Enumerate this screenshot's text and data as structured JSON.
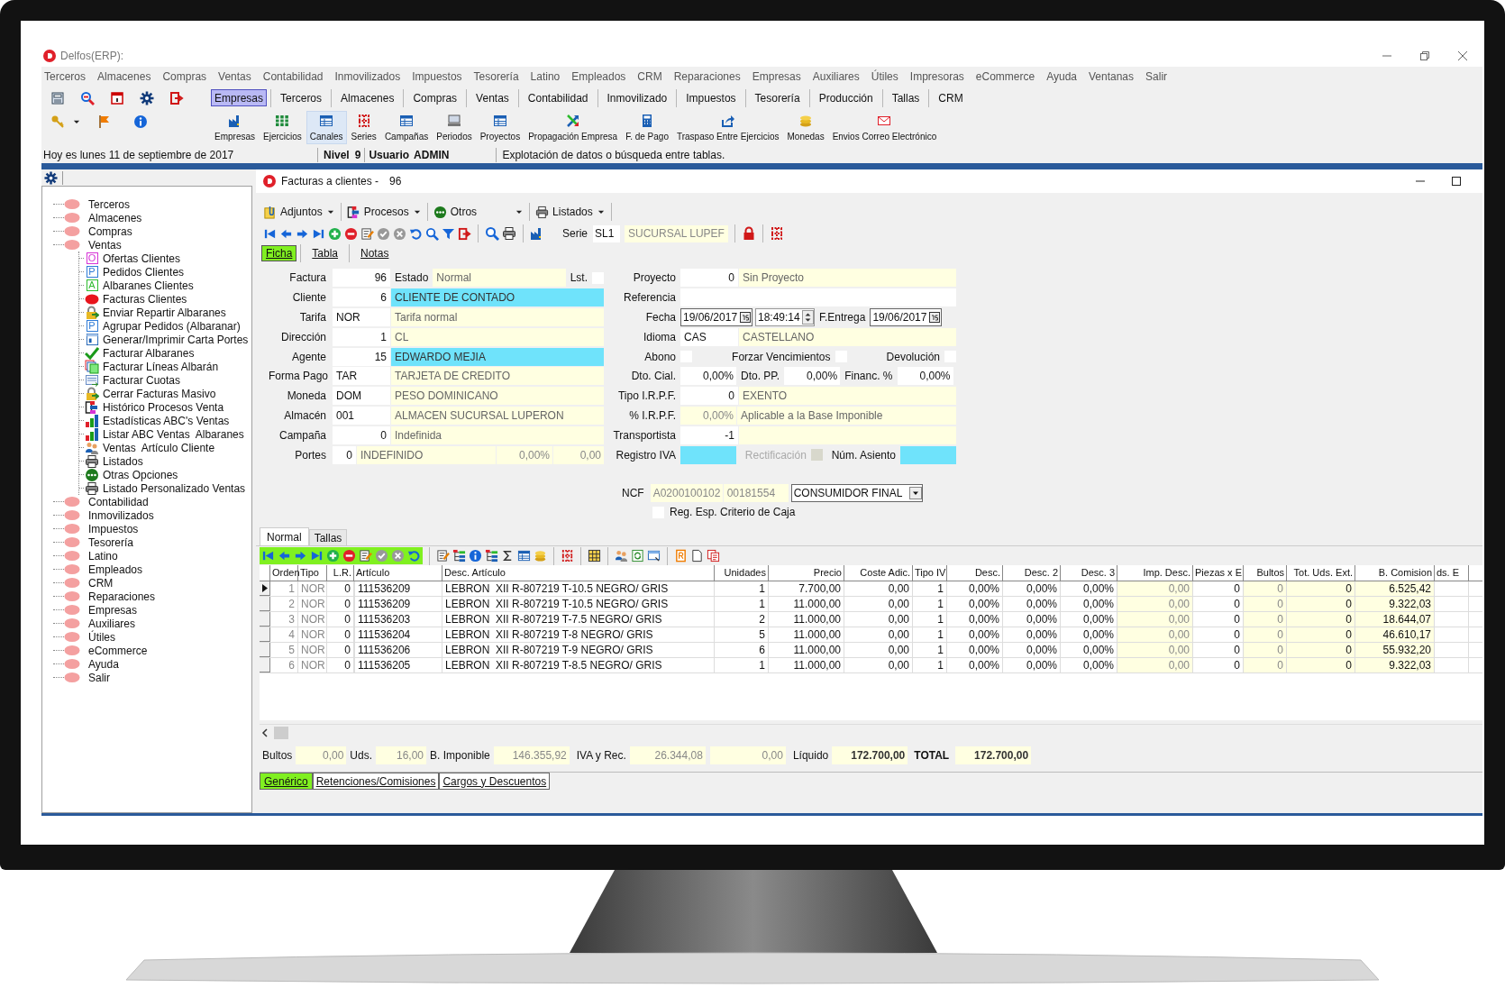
{
  "app": {
    "title": "Delfos(ERP):"
  },
  "menu": [
    "Terceros",
    "Almacenes",
    "Compras",
    "Ventas",
    "Contabilidad",
    "Inmovilizados",
    "Impuestos",
    "Tesorería",
    "Latino",
    "Empleados",
    "CRM",
    "Reparaciones",
    "Empresas",
    "Auxiliares",
    "Útiles",
    "Impresoras",
    "eCommerce",
    "Ayuda",
    "Ventanas",
    "Salir"
  ],
  "module_tabs": [
    {
      "label": "Empresas",
      "selected": true
    },
    {
      "label": "Terceros",
      "selected": false
    },
    {
      "label": "Almacenes",
      "selected": false
    },
    {
      "label": "Compras",
      "selected": false
    },
    {
      "label": "Ventas",
      "selected": false
    },
    {
      "label": "Contabilidad",
      "selected": false
    },
    {
      "label": "Inmovilizado",
      "selected": false
    },
    {
      "label": "Impuestos",
      "selected": false
    },
    {
      "label": "Tesorería",
      "selected": false
    },
    {
      "label": "Producción",
      "selected": false
    },
    {
      "label": "Tallas",
      "selected": false
    },
    {
      "label": "CRM",
      "selected": false
    }
  ],
  "module_tools": [
    {
      "label": "Empresas",
      "selected": false
    },
    {
      "label": "Ejercicios",
      "selected": false
    },
    {
      "label": "Canales",
      "selected": true
    },
    {
      "label": "Series",
      "selected": false
    },
    {
      "label": "Campañas",
      "selected": false
    },
    {
      "label": "Periodos",
      "selected": false
    },
    {
      "label": "Proyectos",
      "selected": false
    },
    {
      "label": "Propagación Empresa",
      "selected": false
    },
    {
      "label": "F. de Pago",
      "selected": false
    },
    {
      "label": "Traspaso Entre Ejercicios",
      "selected": false
    },
    {
      "label": "Monedas",
      "selected": false
    },
    {
      "label": "Envios Correo Electrónico",
      "selected": false
    }
  ],
  "status_bar": {
    "date": "Hoy es lunes 11 de septiembre de 2017",
    "nivel_label": "Nivel",
    "nivel": "9",
    "user_label": "Usuario",
    "user": "ADMIN",
    "message": "Explotación de datos o búsqueda entre tablas."
  },
  "sidebar": {
    "items": [
      {
        "label": "Terceros"
      },
      {
        "label": "Almacenes"
      },
      {
        "label": "Compras"
      },
      {
        "label": "Ventas",
        "children": [
          {
            "label": "Ofertas Clientes",
            "kind": "letter",
            "icon_text": "O",
            "color": "#d633d6"
          },
          {
            "label": "Pedidos Clientes",
            "kind": "letter",
            "icon_text": "P",
            "color": "#2f7bd6"
          },
          {
            "label": "Albaranes Clientes",
            "kind": "letter",
            "icon_text": "A",
            "color": "#2dbb2d"
          },
          {
            "label": "Facturas Clientes",
            "kind": "blob"
          },
          {
            "label": "Enviar Repartir Albaranes",
            "kind": "lock"
          },
          {
            "label": "Agrupar Pedidos (Albaranar)",
            "kind": "letter",
            "icon_text": "P",
            "color": "#2f7bd6"
          },
          {
            "label": "Generar/Imprimir Carta Portes",
            "kind": "form"
          },
          {
            "label": "Facturar Albaranes",
            "kind": "check"
          },
          {
            "label": "Facturar Líneas Albarán",
            "kind": "copies"
          },
          {
            "label": "Facturar Cuotas",
            "kind": "list"
          },
          {
            "label": "Cerrar Facturas Masivo",
            "kind": "lock"
          },
          {
            "label": "Histórico Procesos Venta",
            "kind": "process"
          },
          {
            "label": "Estadísticas ABC's Ventas",
            "kind": "chart"
          },
          {
            "label": "Listar ABC Ventas  Albaranes",
            "kind": "chart"
          },
          {
            "label": "Ventas  Artículo Cliente",
            "kind": "people"
          },
          {
            "label": "Listados",
            "kind": "printer"
          },
          {
            "label": "Otras Opciones",
            "kind": "dots"
          },
          {
            "label": "Listado Personalizado Ventas",
            "kind": "printer"
          }
        ]
      },
      {
        "label": "Contabilidad"
      },
      {
        "label": "Inmovilizados"
      },
      {
        "label": "Impuestos"
      },
      {
        "label": "Tesorería"
      },
      {
        "label": "Latino"
      },
      {
        "label": "Empleados"
      },
      {
        "label": "CRM"
      },
      {
        "label": "Reparaciones"
      },
      {
        "label": "Empresas"
      },
      {
        "label": "Auxiliares"
      },
      {
        "label": "Útiles"
      },
      {
        "label": "eCommerce"
      },
      {
        "label": "Ayuda"
      },
      {
        "label": "Salir"
      }
    ]
  },
  "window": {
    "title": "Facturas a clientes -",
    "number": "96"
  },
  "action_menus": [
    "Adjuntos",
    "Procesos",
    "Otros",
    "Listados"
  ],
  "serie": {
    "label": "Serie",
    "code": "SL1",
    "name": "SUCURSAL LUPEF"
  },
  "form_tabs": [
    {
      "label": "Ficha",
      "selected": true
    },
    {
      "label": "Tabla",
      "selected": false
    },
    {
      "label": "Notas",
      "selected": false
    }
  ],
  "form_left": [
    {
      "cells": [
        {
          "kind": "label",
          "text": "Factura"
        },
        {
          "kind": "num",
          "text": "96"
        },
        {
          "kind": "label_inline",
          "text": "Estado"
        },
        {
          "kind": "desc",
          "text": "Normal"
        },
        {
          "kind": "label_inline",
          "text": "Lst."
        },
        {
          "kind": "check",
          "checked": false
        }
      ]
    },
    {
      "cells": [
        {
          "kind": "label",
          "text": "Cliente"
        },
        {
          "kind": "num",
          "text": "6"
        },
        {
          "kind": "cyan",
          "text": "CLIENTE DE CONTADO"
        }
      ]
    },
    {
      "cells": [
        {
          "kind": "label",
          "text": "Tarifa"
        },
        {
          "kind": "code",
          "text": "NOR"
        },
        {
          "kind": "desc",
          "text": "Tarifa normal"
        }
      ]
    },
    {
      "cells": [
        {
          "kind": "label",
          "text": "Dirección"
        },
        {
          "kind": "num",
          "text": "1"
        },
        {
          "kind": "desc",
          "text": "CL"
        }
      ]
    },
    {
      "cells": [
        {
          "kind": "label",
          "text": "Agente"
        },
        {
          "kind": "num",
          "text": "15"
        },
        {
          "kind": "cyan",
          "text": "EDWARDO MEJIA"
        }
      ]
    },
    {
      "cells": [
        {
          "kind": "label",
          "text": "Forma Pago"
        },
        {
          "kind": "code",
          "text": "TAR"
        },
        {
          "kind": "desc",
          "text": "TARJETA DE CREDITO"
        }
      ]
    },
    {
      "cells": [
        {
          "kind": "label",
          "text": "Moneda"
        },
        {
          "kind": "code",
          "text": "DOM"
        },
        {
          "kind": "desc",
          "text": "PESO DOMINICANO"
        }
      ]
    },
    {
      "cells": [
        {
          "kind": "label",
          "text": "Almacén"
        },
        {
          "kind": "code",
          "text": "001"
        },
        {
          "kind": "desc",
          "text": "ALMACEN SUCURSAL LUPERON"
        }
      ]
    },
    {
      "cells": [
        {
          "kind": "label",
          "text": "Campaña"
        },
        {
          "kind": "num",
          "text": "0"
        },
        {
          "kind": "desc",
          "text": "Indefinida"
        }
      ]
    },
    {
      "cells": [
        {
          "kind": "label",
          "text": "Portes"
        },
        {
          "kind": "num_small",
          "text": "0"
        },
        {
          "kind": "desc",
          "text": "INDEFINIDO"
        },
        {
          "kind": "pct_cream",
          "text": "0,00%"
        },
        {
          "kind": "amount_cream",
          "text": "0,00"
        }
      ]
    }
  ],
  "form_right": [
    {
      "cells": [
        {
          "kind": "label",
          "text": "Proyecto"
        },
        {
          "kind": "num",
          "text": "0"
        },
        {
          "kind": "desc",
          "text": "Sin Proyecto"
        }
      ]
    },
    {
      "cells": [
        {
          "kind": "label",
          "text": "Referencia"
        },
        {
          "kind": "input"
        }
      ]
    },
    {
      "cells": [
        {
          "kind": "label",
          "text": "Fecha"
        },
        {
          "kind": "date",
          "text": "19/06/2017"
        },
        {
          "kind": "time",
          "text": "18:49:14"
        },
        {
          "kind": "label_inline",
          "text": "F.Entrega"
        },
        {
          "kind": "date",
          "text": "19/06/2017"
        }
      ]
    },
    {
      "cells": [
        {
          "kind": "label",
          "text": "Idioma"
        },
        {
          "kind": "code",
          "text": "CAS"
        },
        {
          "kind": "desc",
          "text": "CASTELLANO"
        }
      ]
    },
    {
      "cells": [
        {
          "kind": "label",
          "text": "Abono"
        },
        {
          "kind": "check",
          "checked": false
        },
        {
          "kind": "label_inline",
          "text": "Forzar Vencimientos"
        },
        {
          "kind": "check",
          "checked": false
        },
        {
          "kind": "label_inline",
          "text": "Devolución"
        },
        {
          "kind": "check",
          "checked": false
        }
      ]
    },
    {
      "cells": [
        {
          "kind": "label",
          "text": "Dto. Cial."
        },
        {
          "kind": "pct",
          "text": "0,00%"
        },
        {
          "kind": "label_inline",
          "text": "Dto. PP."
        },
        {
          "kind": "pct",
          "text": "0,00%"
        },
        {
          "kind": "label_inline",
          "text": "Financ. %"
        },
        {
          "kind": "pct",
          "text": "0,00%"
        }
      ]
    },
    {
      "cells": [
        {
          "kind": "label",
          "text": "Tipo I.R.P.F."
        },
        {
          "kind": "num",
          "text": "0"
        },
        {
          "kind": "desc",
          "text": "EXENTO"
        }
      ]
    },
    {
      "cells": [
        {
          "kind": "label",
          "text": "% I.R.P.F."
        },
        {
          "kind": "pct_cream",
          "text": "0,00%"
        },
        {
          "kind": "desc",
          "text": "Aplicable a la Base Imponible"
        }
      ]
    },
    {
      "cells": [
        {
          "kind": "label",
          "text": "Transportista"
        },
        {
          "kind": "num",
          "text": "-1"
        },
        {
          "kind": "desc"
        }
      ]
    },
    {
      "cells": [
        {
          "kind": "label",
          "text": "Registro IVA"
        },
        {
          "kind": "cyan_box"
        },
        {
          "kind": "label_disabled",
          "text": "Rectificación"
        },
        {
          "kind": "check",
          "checked": false,
          "disabled": true
        },
        {
          "kind": "label_inline",
          "text": "Núm. Asiento"
        },
        {
          "kind": "cyan_box"
        }
      ]
    }
  ],
  "ncf": {
    "label": "NCF",
    "code": "A0200100102",
    "number": "00181554",
    "type": "CONSUMIDOR FINAL"
  },
  "reg_esp": {
    "label": "Reg. Esp. Criterio de Caja",
    "checked": false
  },
  "grid_tabs": [
    {
      "label": "Normal",
      "selected": true
    },
    {
      "label": "Tallas",
      "selected": false
    }
  ],
  "table": {
    "columns": [
      "Orden",
      "Tipo",
      "L.R.",
      "Artículo",
      "Desc. Artículo",
      "Unidades",
      "Precio",
      "Coste Adic.",
      "Tipo IV",
      "Desc.",
      "Desc. 2",
      "Desc. 3",
      "Imp. Desc.",
      "Piezas x E",
      "Bultos",
      "Tot. Uds. Ext.",
      "B. Comision",
      "ds. E"
    ],
    "rows": [
      {
        "selected": true,
        "cells": [
          "1",
          "NOR",
          "0",
          "111536209",
          "LEBRON  XII R-807219 T-10.5 NEGRO/ GRIS",
          "1",
          "7.700,00",
          "0,00",
          "1",
          "0,00%",
          "0,00%",
          "0,00%",
          "0,00",
          "0",
          "0",
          "0",
          "6.525,42"
        ]
      },
      {
        "selected": false,
        "cells": [
          "2",
          "NOR",
          "0",
          "111536209",
          "LEBRON  XII R-807219 T-10.5 NEGRO/ GRIS",
          "1",
          "11.000,00",
          "0,00",
          "1",
          "0,00%",
          "0,00%",
          "0,00%",
          "0,00",
          "0",
          "0",
          "0",
          "9.322,03"
        ]
      },
      {
        "selected": false,
        "cells": [
          "3",
          "NOR",
          "0",
          "111536203",
          "LEBRON  XII R-807219 T-7.5 NEGRO/ GRIS",
          "2",
          "11.000,00",
          "0,00",
          "1",
          "0,00%",
          "0,00%",
          "0,00%",
          "0,00",
          "0",
          "0",
          "0",
          "18.644,07"
        ]
      },
      {
        "selected": false,
        "cells": [
          "4",
          "NOR",
          "0",
          "111536204",
          "LEBRON  XII R-807219 T-8 NEGRO/ GRIS",
          "5",
          "11.000,00",
          "0,00",
          "1",
          "0,00%",
          "0,00%",
          "0,00%",
          "0,00",
          "0",
          "0",
          "0",
          "46.610,17"
        ]
      },
      {
        "selected": false,
        "cells": [
          "5",
          "NOR",
          "0",
          "111536206",
          "LEBRON  XII R-807219 T-9 NEGRO/ GRIS",
          "6",
          "11.000,00",
          "0,00",
          "1",
          "0,00%",
          "0,00%",
          "0,00%",
          "0,00",
          "0",
          "0",
          "0",
          "55.932,20"
        ]
      },
      {
        "selected": false,
        "cells": [
          "6",
          "NOR",
          "0",
          "111536205",
          "LEBRON  XII R-807219 T-8.5 NEGRO/ GRIS",
          "1",
          "11.000,00",
          "0,00",
          "1",
          "0,00%",
          "0,00%",
          "0,00%",
          "0,00",
          "0",
          "0",
          "0",
          "9.322,03"
        ]
      }
    ]
  },
  "totals": [
    {
      "kind": "label",
      "text": "Bultos"
    },
    {
      "kind": "value_sm",
      "text": "0,00"
    },
    {
      "kind": "label",
      "text": "Uds."
    },
    {
      "kind": "value_sm",
      "text": "16,00"
    },
    {
      "kind": "label",
      "text": "B. Imponible"
    },
    {
      "kind": "value",
      "text": "146.355,92"
    },
    {
      "kind": "label",
      "text": "IVA y Rec."
    },
    {
      "kind": "value",
      "text": "26.344,08"
    },
    {
      "kind": "value",
      "text": "0,00"
    },
    {
      "kind": "label",
      "text": "Líquido"
    },
    {
      "kind": "value_bold",
      "text": "172.700,00"
    },
    {
      "kind": "label_bold",
      "text": "TOTAL"
    },
    {
      "kind": "value_bold",
      "text": "172.700,00"
    }
  ],
  "bottom_tabs": [
    {
      "label": "Genérico",
      "selected": true
    },
    {
      "label": "Retenciones/Comisiones",
      "selected": false
    },
    {
      "label": "Cargos y Descuentos",
      "selected": false
    }
  ]
}
